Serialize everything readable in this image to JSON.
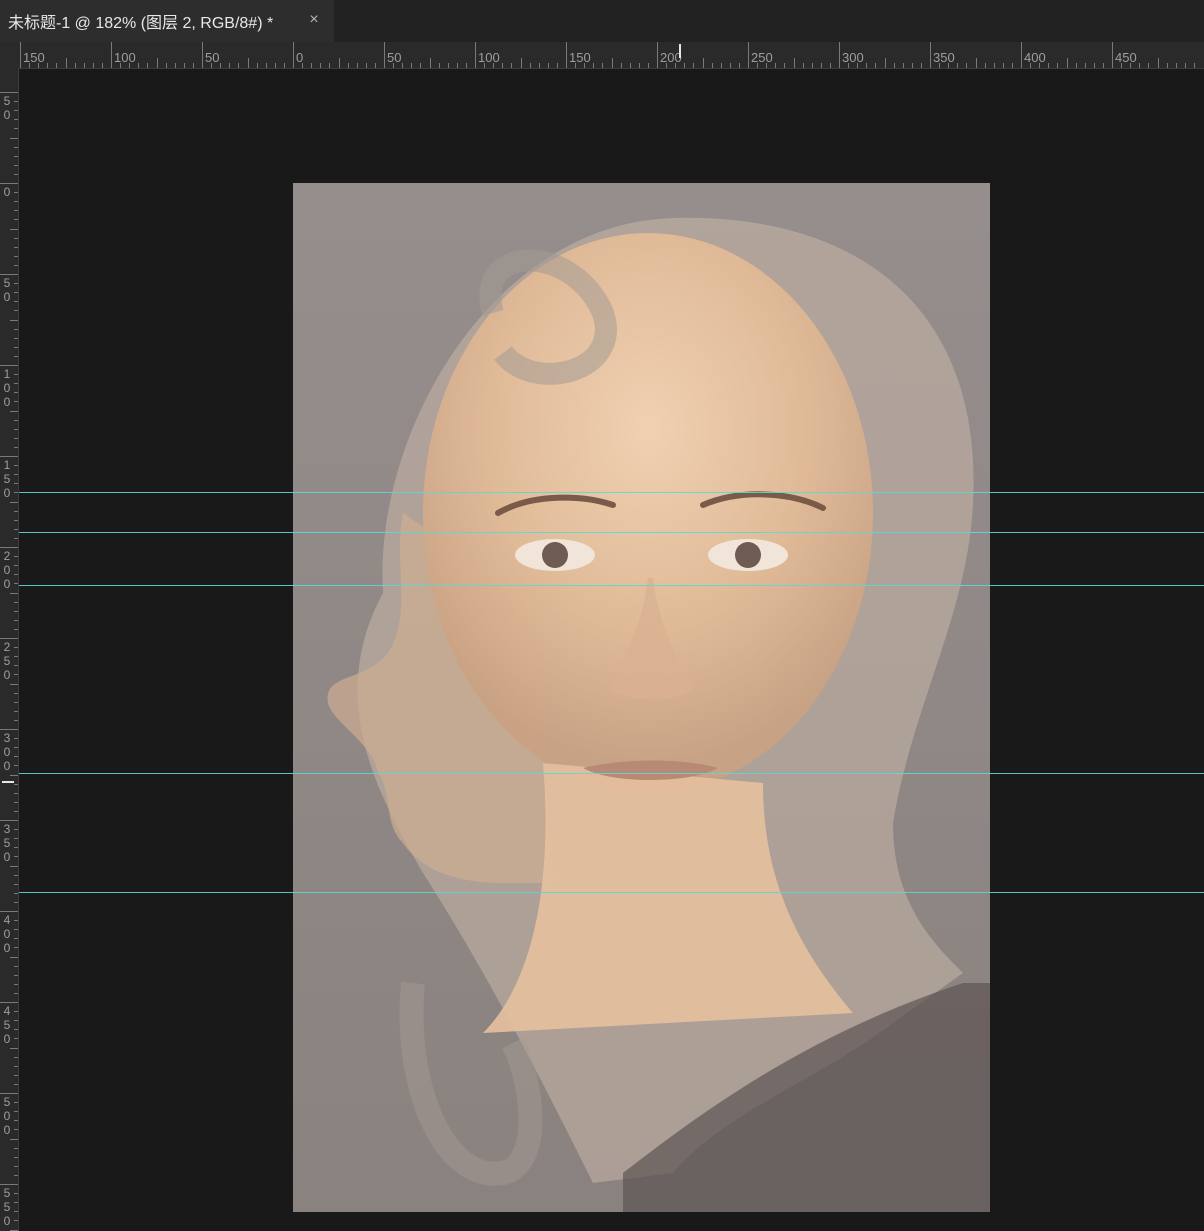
{
  "tab": {
    "title": "未标题-1 @ 182% (图层 2, RGB/8#) *",
    "close": "×"
  },
  "rulers": {
    "horizontal": [
      "150",
      "100",
      "50",
      "0",
      "50",
      "100",
      "150",
      "200",
      "250",
      "300",
      "350",
      "400",
      "450"
    ],
    "vertical": [
      "50",
      "0",
      "50",
      "100",
      "150",
      "200",
      "250",
      "300",
      "350",
      "400",
      "450",
      "500",
      "550"
    ]
  },
  "guides_count": 5,
  "canvas": {
    "background_color": "#8f8985",
    "skin_color": "#e8c4a2",
    "overlay_color": "#c9b8a8"
  }
}
